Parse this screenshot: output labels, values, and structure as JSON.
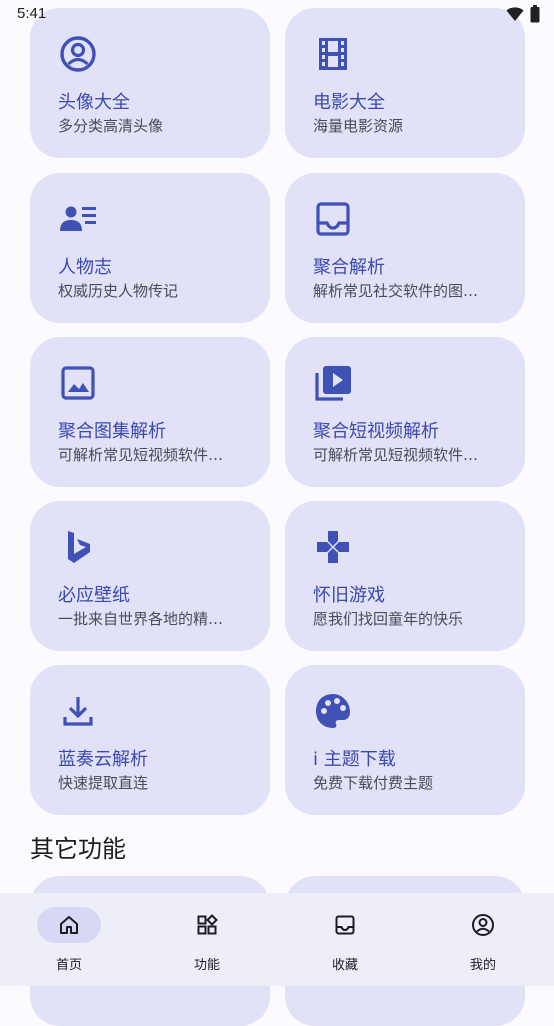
{
  "status_bar": {
    "time": "5:41"
  },
  "cards": [
    {
      "title": "头像大全",
      "subtitle": "多分类高清头像",
      "icon": "account-circle-icon"
    },
    {
      "title": "电影大全",
      "subtitle": "海量电影资源",
      "icon": "movie-icon"
    },
    {
      "title": "人物志",
      "subtitle": "权威历史人物传记",
      "icon": "person-list-icon"
    },
    {
      "title": "聚合解析",
      "subtitle": "解析常见社交软件的图…",
      "icon": "inbox-icon"
    },
    {
      "title": "聚合图集解析",
      "subtitle": "可解析常见短视频软件…",
      "icon": "image-icon"
    },
    {
      "title": "聚合短视频解析",
      "subtitle": "可解析常见短视频软件…",
      "icon": "video-library-icon"
    },
    {
      "title": "必应壁纸",
      "subtitle": "一批来自世界各地的精…",
      "icon": "bing-icon"
    },
    {
      "title": "怀旧游戏",
      "subtitle": "愿我们找回童年的快乐",
      "icon": "gamepad-icon"
    },
    {
      "title": "蓝奏云解析",
      "subtitle": "快速提取直连",
      "icon": "download-icon"
    },
    {
      "title": "i 主题下载",
      "subtitle": "免费下载付费主题",
      "icon": "palette-icon"
    }
  ],
  "section": {
    "title": "其它功能"
  },
  "bottom_nav": {
    "items": [
      {
        "label": "首页",
        "icon": "home-icon",
        "active": true
      },
      {
        "label": "功能",
        "icon": "widgets-icon",
        "active": false
      },
      {
        "label": "收藏",
        "icon": "inbox-icon",
        "active": false
      },
      {
        "label": "我的",
        "icon": "account-circle-icon",
        "active": false
      }
    ]
  },
  "colors": {
    "accent": "#3f51b5",
    "card_bg": "#e1e1f7",
    "title": "#3b49b0",
    "nav_bg": "#eeeef9",
    "nav_active": "#d7d8f3"
  }
}
